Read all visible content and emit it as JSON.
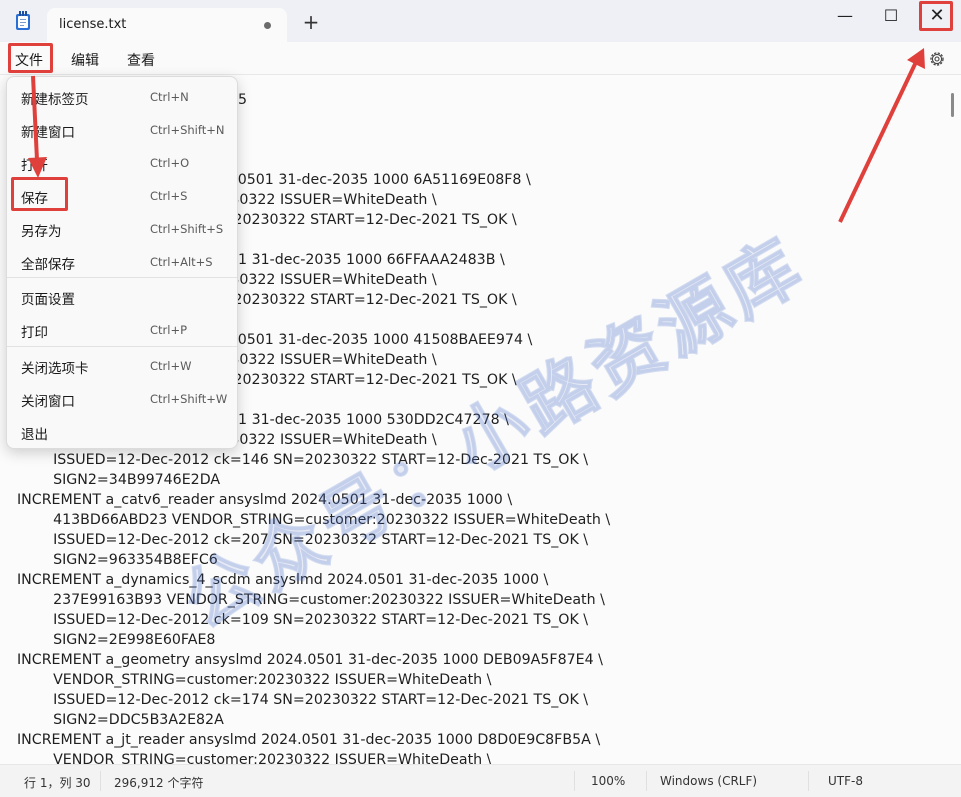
{
  "window": {
    "tab_title": "license.txt",
    "new_tab_icon": "plus-icon",
    "minimize_glyph": "—",
    "maximize_glyph": "☐",
    "close_glyph": "✕"
  },
  "menubar": {
    "file": "文件",
    "edit": "编辑",
    "view": "查看"
  },
  "file_menu": {
    "items": [
      {
        "label": "新建标签页",
        "shortcut": "Ctrl+N"
      },
      {
        "label": "新建窗口",
        "shortcut": "Ctrl+Shift+N"
      },
      {
        "label": "打开",
        "shortcut": "Ctrl+O"
      },
      {
        "label": "保存",
        "shortcut": "Ctrl+S"
      },
      {
        "label": "另存为",
        "shortcut": "Ctrl+Shift+S"
      },
      {
        "label": "全部保存",
        "shortcut": "Ctrl+Alt+S"
      },
      {
        "label": "页面设置",
        "shortcut": ""
      },
      {
        "label": "打印",
        "shortcut": "Ctrl+P"
      },
      {
        "label": "关闭选项卡",
        "shortcut": "Ctrl+W"
      },
      {
        "label": "关闭窗口",
        "shortcut": "Ctrl+Shift+W"
      },
      {
        "label": "退出",
        "shortcut": ""
      }
    ]
  },
  "editor": {
    "lines": [
      "                                      67 1055",
      "",
      "",
      "",
      "                                 lmd 2024.0501 31-dec-2035 1000 6A51169E08F8 \\",
      "                                  mer:20230322 ISSUER=WhiteDeath \\",
      "                                  161 SN=20230322 START=12-Dec-2021 TS_OK \\",
      "",
      "                                  2024.0501 31-dec-2035 1000 66FFAAA2483B \\",
      "                                  mer:20230322 ISSUER=WhiteDeath \\",
      "                                  151 SN=20230322 START=12-Dec-2021 TS_OK \\",
      "",
      "                                 lmd 2024.0501 31-dec-2035 1000 41508BAEE974 \\",
      "                                  mer:20230322 ISSUER=WhiteDeath \\",
      "                                  125 SN=20230322 START=12-Dec-2021 TS_OK \\",
      "",
      "                                  2024.0501 31-dec-2035 1000 530DD2C47278 \\",
      "                                  mer:20230322 ISSUER=WhiteDeath \\",
      "        ISSUED=12-Dec-2012 ck=146 SN=20230322 START=12-Dec-2021 TS_OK \\",
      "        SIGN2=34B99746E2DA",
      "INCREMENT a_catv6_reader ansyslmd 2024.0501 31-dec-2035 1000 \\",
      "        413BD66ABD23 VENDOR_STRING=customer:20230322 ISSUER=WhiteDeath \\",
      "        ISSUED=12-Dec-2012 ck=207 SN=20230322 START=12-Dec-2021 TS_OK \\",
      "        SIGN2=963354B8EFC6",
      "INCREMENT a_dynamics_4_scdm ansyslmd 2024.0501 31-dec-2035 1000 \\",
      "        237E99163B93 VENDOR_STRING=customer:20230322 ISSUER=WhiteDeath \\",
      "        ISSUED=12-Dec-2012 ck=109 SN=20230322 START=12-Dec-2021 TS_OK \\",
      "        SIGN2=2E998E60FAE8",
      "INCREMENT a_geometry ansyslmd 2024.0501 31-dec-2035 1000 DEB09A5F87E4 \\",
      "        VENDOR_STRING=customer:20230322 ISSUER=WhiteDeath \\",
      "        ISSUED=12-Dec-2012 ck=174 SN=20230322 START=12-Dec-2021 TS_OK \\",
      "        SIGN2=DDC5B3A2E82A",
      "INCREMENT a_jt_reader ansyslmd 2024.0501 31-dec-2035 1000 D8D0E9C8FB5A \\",
      "        VENDOR_STRING=customer:20230322 ISSUER=WhiteDeath \\"
    ]
  },
  "watermark": "公众号：小路资源库",
  "status": {
    "position": "行 1，列 30",
    "char_count": "296,912 个字符",
    "zoom": "100%",
    "line_ending": "Windows (CRLF)",
    "encoding": "UTF-8"
  },
  "colors": {
    "annotation_red": "#e0403b"
  }
}
